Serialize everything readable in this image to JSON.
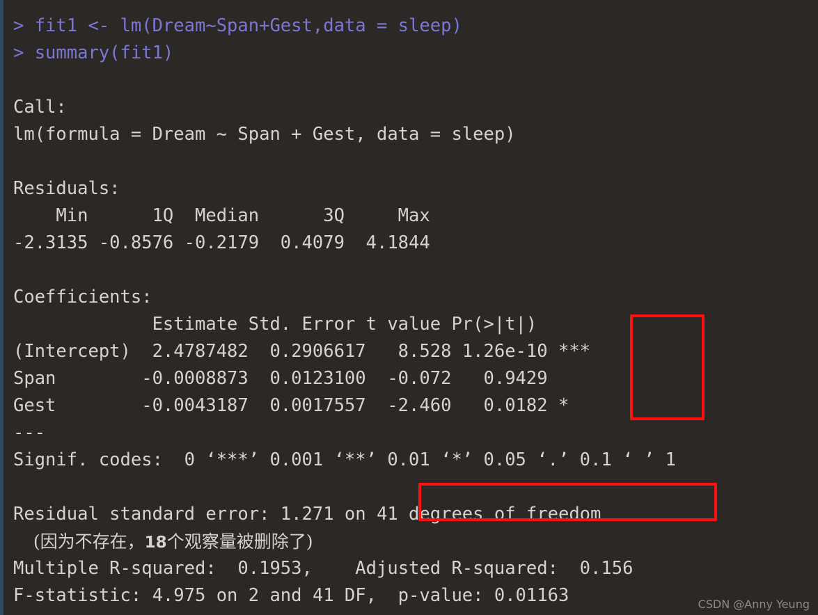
{
  "theme": {
    "background": "#2b2825",
    "output_text": "#d6d2cd",
    "command_text": "#7b77d6",
    "gutter": "#2d4a60",
    "annotation_red": "#ff1111",
    "watermark_text": "#8f8b87"
  },
  "console": {
    "prompt": ">",
    "lines": [
      {
        "kind": "command",
        "text": "> fit1 <- lm(Dream~Span+Gest,data = sleep)"
      },
      {
        "kind": "command",
        "text": "> summary(fit1)"
      },
      {
        "kind": "blank",
        "text": ""
      },
      {
        "kind": "output",
        "text": "Call:"
      },
      {
        "kind": "output",
        "text": "lm(formula = Dream ~ Span + Gest, data = sleep)"
      },
      {
        "kind": "blank",
        "text": ""
      },
      {
        "kind": "output",
        "text": "Residuals:"
      },
      {
        "kind": "output",
        "text": "    Min      1Q  Median      3Q     Max "
      },
      {
        "kind": "output",
        "text": "-2.3135 -0.8576 -0.2179  0.4079  4.1844 "
      },
      {
        "kind": "blank",
        "text": ""
      },
      {
        "kind": "output",
        "text": "Coefficients:"
      },
      {
        "kind": "output",
        "text": "             Estimate Std. Error t value Pr(>|t|)    "
      },
      {
        "kind": "output",
        "text": "(Intercept)  2.4787482  0.2906617   8.528 1.26e-10 ***"
      },
      {
        "kind": "output",
        "text": "Span        -0.0008873  0.0123100  -0.072   0.9429    "
      },
      {
        "kind": "output",
        "text": "Gest        -0.0043187  0.0017557  -2.460   0.0182 *  "
      },
      {
        "kind": "output",
        "text": "---"
      },
      {
        "kind": "output",
        "text": "Signif. codes:  0 ‘***’ 0.001 ‘**’ 0.01 ‘*’ 0.05 ‘.’ 0.1 ‘ ’ 1"
      },
      {
        "kind": "blank",
        "text": ""
      },
      {
        "kind": "output",
        "text": "Residual standard error: 1.271 on 41 degrees of freedom"
      },
      {
        "kind": "cjk",
        "text": "  (因为不存在，18个观察量被删除了)",
        "segments": [
          {
            "type": "space",
            "text": "  "
          },
          {
            "type": "cjk",
            "text": "(因为不存在，"
          },
          {
            "type": "num",
            "text": "18"
          },
          {
            "type": "cjk",
            "text": "个观察量被删除了)"
          }
        ]
      },
      {
        "kind": "output",
        "text": "Multiple R-squared:  0.1953,\tAdjusted R-squared:  0.156 "
      },
      {
        "kind": "output",
        "text": "F-statistic: 4.975 on 2 and 41 DF,  p-value: 0.01163"
      }
    ]
  },
  "model": {
    "command": "fit1 <- lm(Dream~Span+Gest,data = sleep)",
    "summary_command": "summary(fit1)",
    "call_label": "Call:",
    "call_formula": "lm(formula = Dream ~ Span + Gest, data = sleep)",
    "residuals_label": "Residuals:",
    "residuals": {
      "headers": [
        "Min",
        "1Q",
        "Median",
        "3Q",
        "Max"
      ],
      "values": [
        "-2.3135",
        "-0.8576",
        "-0.2179",
        "0.4079",
        "4.1844"
      ]
    },
    "coefficients_label": "Coefficients:",
    "coefficients": {
      "headers": [
        "",
        "Estimate",
        "Std. Error",
        "t value",
        "Pr(>|t|)",
        ""
      ],
      "rows": [
        {
          "term": "(Intercept)",
          "estimate": "2.4787482",
          "std_error": "0.2906617",
          "t_value": "8.528",
          "p_value": "1.26e-10",
          "signif": "***"
        },
        {
          "term": "Span",
          "estimate": "-0.0008873",
          "std_error": "0.0123100",
          "t_value": "-0.072",
          "p_value": "0.9429",
          "signif": ""
        },
        {
          "term": "Gest",
          "estimate": "-0.0043187",
          "std_error": "0.0017557",
          "t_value": "-2.460",
          "p_value": "0.0182",
          "signif": "*"
        }
      ]
    },
    "separator": "---",
    "signif_codes": "Signif. codes:  0 ‘***’ 0.001 ‘**’ 0.01 ‘*’ 0.05 ‘.’ 0.1 ‘ ’ 1",
    "residual_standard_error": {
      "text": "Residual standard error: 1.271 on 41 degrees of freedom",
      "value": "1.271",
      "degrees_of_freedom": "41"
    },
    "deleted_observations_note": "(因为不存在，18个观察量被删除了)",
    "deleted_observations_count": "18",
    "r_squared": {
      "multiple_label": "Multiple R-squared:",
      "multiple_value": "0.1953",
      "adjusted_label": "Adjusted R-squared:",
      "adjusted_value": "0.156"
    },
    "f_statistic": {
      "text": "F-statistic: 4.975 on 2 and 41 DF,  p-value: 0.01163",
      "value": "4.975",
      "df1": "2",
      "df2": "41",
      "p_value": "0.01163"
    }
  },
  "annotations": [
    {
      "name": "redbox-signif-codes",
      "target": "significance stars column"
    },
    {
      "name": "redbox-degrees-freedom",
      "target": "41 degrees of freedom"
    }
  ],
  "watermark": {
    "text": "CSDN @Anny Yeung"
  }
}
